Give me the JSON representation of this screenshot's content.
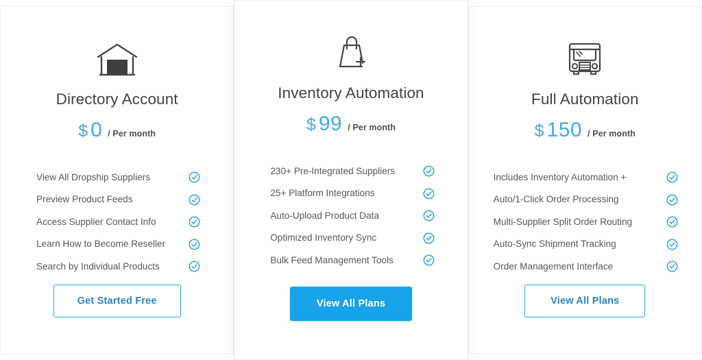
{
  "accent": {
    "blue": "#41abe1",
    "button_blue": "#17a3ea",
    "outline_blue": "#2ba4e0",
    "outline_text": "#2c83c3",
    "icon_dark": "#444849",
    "text_gray": "#53585c",
    "title_gray": "#3f4347"
  },
  "plans": [
    {
      "icon": "warehouse-icon",
      "title": "Directory Account",
      "currency": "$",
      "amount": "0",
      "period": "/ Per month",
      "features": [
        "View All Dropship Suppliers",
        "Preview Product Feeds",
        "Access Supplier Contact Info",
        "Learn How to Become Reseller",
        "Search by Individual Products"
      ],
      "cta": "Get Started Free",
      "cta_style": "outline"
    },
    {
      "icon": "shopping-bag-plus-icon",
      "title": "Inventory Automation",
      "currency": "$",
      "amount": "99",
      "period": "/ Per month",
      "features": [
        "230+ Pre-Integrated Suppliers",
        "25+ Platform Integrations",
        "Auto-Upload Product Data",
        "Optimized Inventory Sync",
        "Bulk Feed Management Tools"
      ],
      "cta": "View All Plans",
      "cta_style": "filled"
    },
    {
      "icon": "delivery-truck-icon",
      "title": "Full Automation",
      "currency": "$",
      "amount": "150",
      "period": "/ Per month",
      "features": [
        "Includes Inventory Automation +",
        "Auto/1-Click Order Processing",
        "Multi-Supplier Split Order Routing",
        "Auto-Sync Shipment Tracking",
        "Order Management Interface"
      ],
      "cta": "View All Plans",
      "cta_style": "outline"
    }
  ],
  "check_icon_name": "check-circle-icon"
}
